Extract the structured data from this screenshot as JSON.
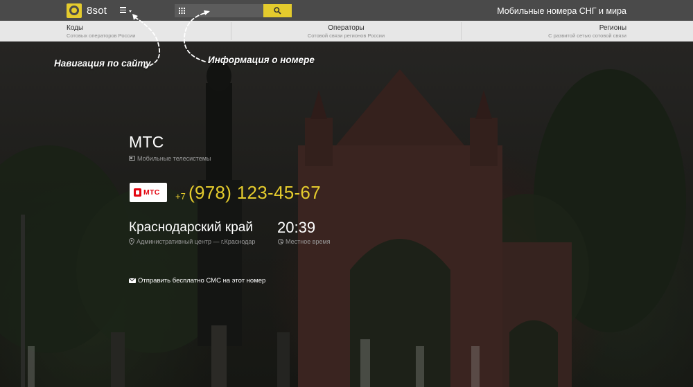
{
  "header": {
    "logo_text": "8sot",
    "search_placeholder": "",
    "tagline": "Мобильные номера СНГ и мира",
    "menu_icon": "hamburger-menu-icon",
    "search_icon": "magnifier-icon",
    "keypad_icon": "keypad-icon"
  },
  "nav": [
    {
      "title": "Коды",
      "subtitle": "Сотовых операторов России"
    },
    {
      "title": "Операторы",
      "subtitle": "Сотовой связи регионов России"
    },
    {
      "title": "Регионы",
      "subtitle": "С развитой сетью сотовой связи"
    }
  ],
  "hints": {
    "navigation": "Навигация по сайту",
    "number_info": "Информация о номере"
  },
  "operator": {
    "name": "МТС",
    "full_name": "Мобильные телесистемы",
    "logo_text": "МТС"
  },
  "phone": {
    "prefix": "+7",
    "number": "(978) 123-45-67"
  },
  "region": {
    "name": "Краснодарский край",
    "subtitle": "Административный центр — г.Краснодар"
  },
  "time": {
    "value": "20:39",
    "subtitle": "Местное время"
  },
  "sms": {
    "label": "Отправить бесплатно СМС на этот номер"
  },
  "colors": {
    "accent": "#e4cb2d",
    "header_bg": "#4a4a4a",
    "subnav_bg": "#e7e7e7",
    "mts_red": "#e30611"
  }
}
